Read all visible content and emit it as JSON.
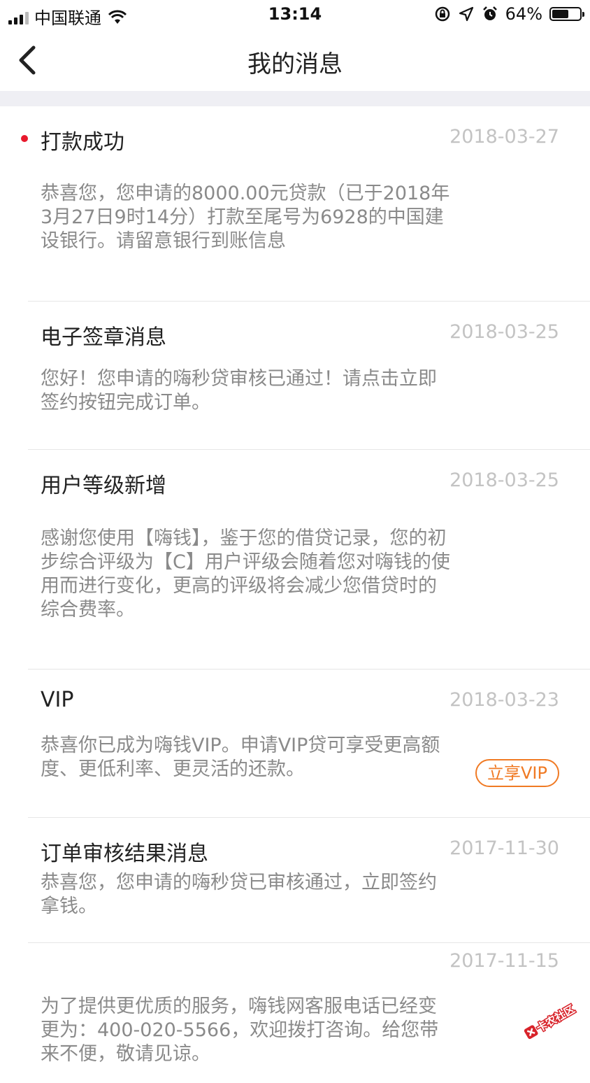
{
  "status_bar": {
    "carrier": "中国联通",
    "time": "13:14",
    "battery": "64%",
    "battery_level": 0.64
  },
  "nav": {
    "title": "我的消息"
  },
  "messages": [
    {
      "title": "打款成功",
      "date": "2018-03-27",
      "unread": true,
      "body": "恭喜您，您申请的8000.00元贷款（已于2018年3月27日9时14分）打款至尾号为6928的中国建设银行。请留意银行到账信息"
    },
    {
      "title": "电子签章消息",
      "date": "2018-03-25",
      "body": "您好！您申请的嗨秒贷审核已通过！请点击立即签约按钮完成订单。"
    },
    {
      "title": "用户等级新增",
      "date": "2018-03-25",
      "body": "感谢您使用【嗨钱】，鉴于您的借贷记录，您的初步综合评级为【C】用户评级会随着您对嗨钱的使用而进行变化，更高的评级将会减少您借贷时的综合费率。"
    },
    {
      "title": "VIP",
      "date": "2018-03-23",
      "body": "恭喜你已成为嗨钱VIP。申请VIP贷可享受更高额度、更低利率、更灵活的还款。",
      "action": "立享VIP"
    },
    {
      "title": "订单审核结果消息",
      "date": "2017-11-30",
      "body": "恭喜您，您申请的嗨秒贷已审核通过，立即签约拿钱。"
    },
    {
      "title": "",
      "date": "2017-11-15",
      "body": "为了提供更优质的服务，嗨钱网客服电话已经变更为：400-020-5566，欢迎拨打咨询。给您带来不便，敬请见谅。"
    }
  ],
  "watermark": "卡农社区",
  "colors": {
    "accent_orange": "#f07a24",
    "unread_dot": "#e8192c",
    "separator": "#efeff4"
  }
}
